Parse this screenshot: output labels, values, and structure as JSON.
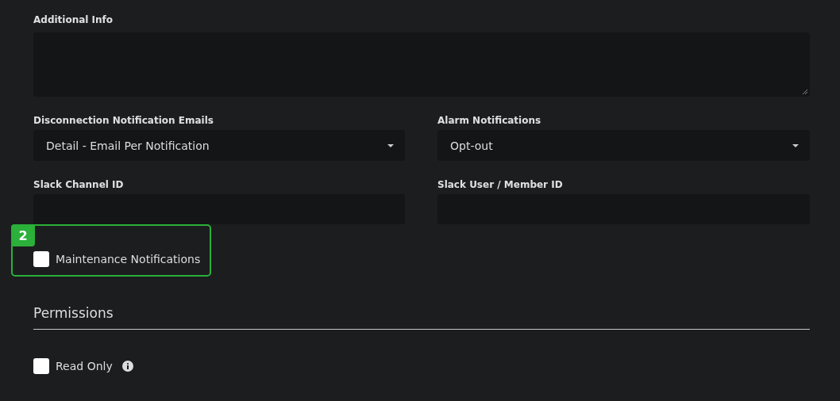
{
  "additional_info": {
    "label": "Additional Info"
  },
  "selects": [
    {
      "label": "Disconnection Notification Emails",
      "value": "Detail - Email Per Notification"
    },
    {
      "label": "Alarm Notifications",
      "value": "Opt-out"
    }
  ],
  "inputs": [
    {
      "label": "Slack Channel ID"
    },
    {
      "label": "Slack User / Member ID"
    }
  ],
  "maintenance": {
    "label": "Maintenance Notifications",
    "checked": false,
    "callout": "2"
  },
  "permissions": {
    "heading": "Permissions",
    "read_only": {
      "label": "Read Only",
      "checked": false,
      "info": true
    }
  }
}
